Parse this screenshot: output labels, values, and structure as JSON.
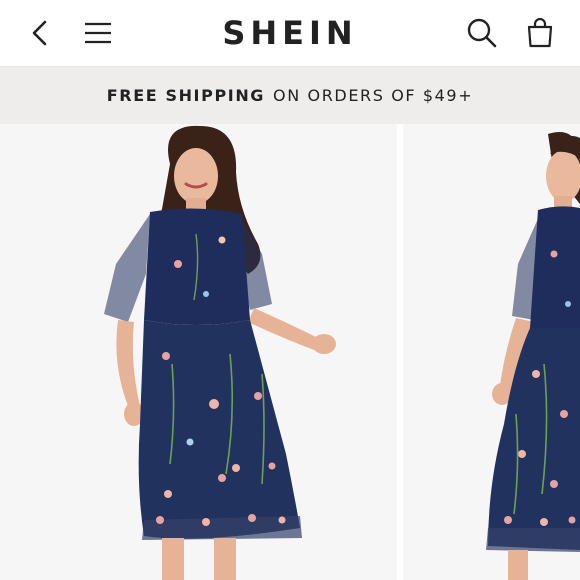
{
  "header": {
    "logo_text": "SHEIN",
    "icons": {
      "back": "chevron-left-icon",
      "menu": "hamburger-menu-icon",
      "search": "search-icon",
      "bag": "shopping-bag-icon"
    }
  },
  "promo": {
    "bold_text": "FREE SHIPPING",
    "rest_text": "ON ORDERS OF $49+"
  },
  "gallery": {
    "images": [
      {
        "name": "product-photo-front",
        "alt": "Navy floral embroidered mesh midi dress, front view"
      },
      {
        "name": "product-photo-side",
        "alt": "Navy floral embroidered mesh midi dress, side view"
      }
    ]
  },
  "colors": {
    "header_bg": "#ffffff",
    "banner_bg": "#efecec",
    "text": "#222222",
    "dress_navy": "#1f2d5c"
  }
}
